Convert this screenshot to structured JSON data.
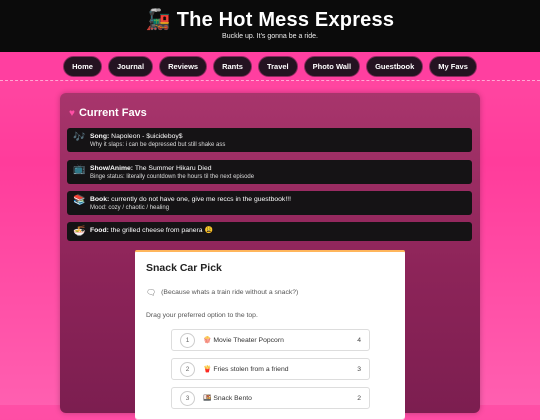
{
  "header": {
    "logo_icon": "🚂",
    "title": "The Hot Mess Express",
    "subtitle": "Buckle up. It's gonna be a ride."
  },
  "nav": {
    "items": [
      "Home",
      "Journal",
      "Reviews",
      "Rants",
      "Travel",
      "Photo Wall",
      "Guestbook",
      "My Favs"
    ]
  },
  "favs": {
    "heading_icon": "heart-icon",
    "heading": "Current Favs",
    "items": [
      {
        "icon": "🎶",
        "label": "Song:",
        "value": "Napoleon - $uicideboy$",
        "note": "Why it slaps: i can be depressed but still shake ass"
      },
      {
        "icon": "📺",
        "label": "Show/Anime:",
        "value": "The Summer Hikaru Died",
        "note": "Binge status: literally countdown the hours til the next episode"
      },
      {
        "icon": "📚",
        "label": "Book:",
        "value": "currently do not have one, give me reccs in the guestbook!!!",
        "note": "Mood: cozy / chaotic / healing"
      },
      {
        "icon": "🍜",
        "label": "Food:",
        "value": "the grilled cheese from panera 😩",
        "note": ""
      }
    ]
  },
  "poll": {
    "title": "Snack Car Pick",
    "description": "(Because whats a train ride without a snack?)",
    "instruction": "Drag your preferred option to the top.",
    "options": [
      {
        "rank": "1",
        "label": "🍿 Movie Theater Popcorn",
        "score": "4"
      },
      {
        "rank": "2",
        "label": "🍟 Fries stolen from a friend",
        "score": "3"
      },
      {
        "rank": "3",
        "label": "🍱 Snack Bento",
        "score": "2"
      }
    ]
  }
}
